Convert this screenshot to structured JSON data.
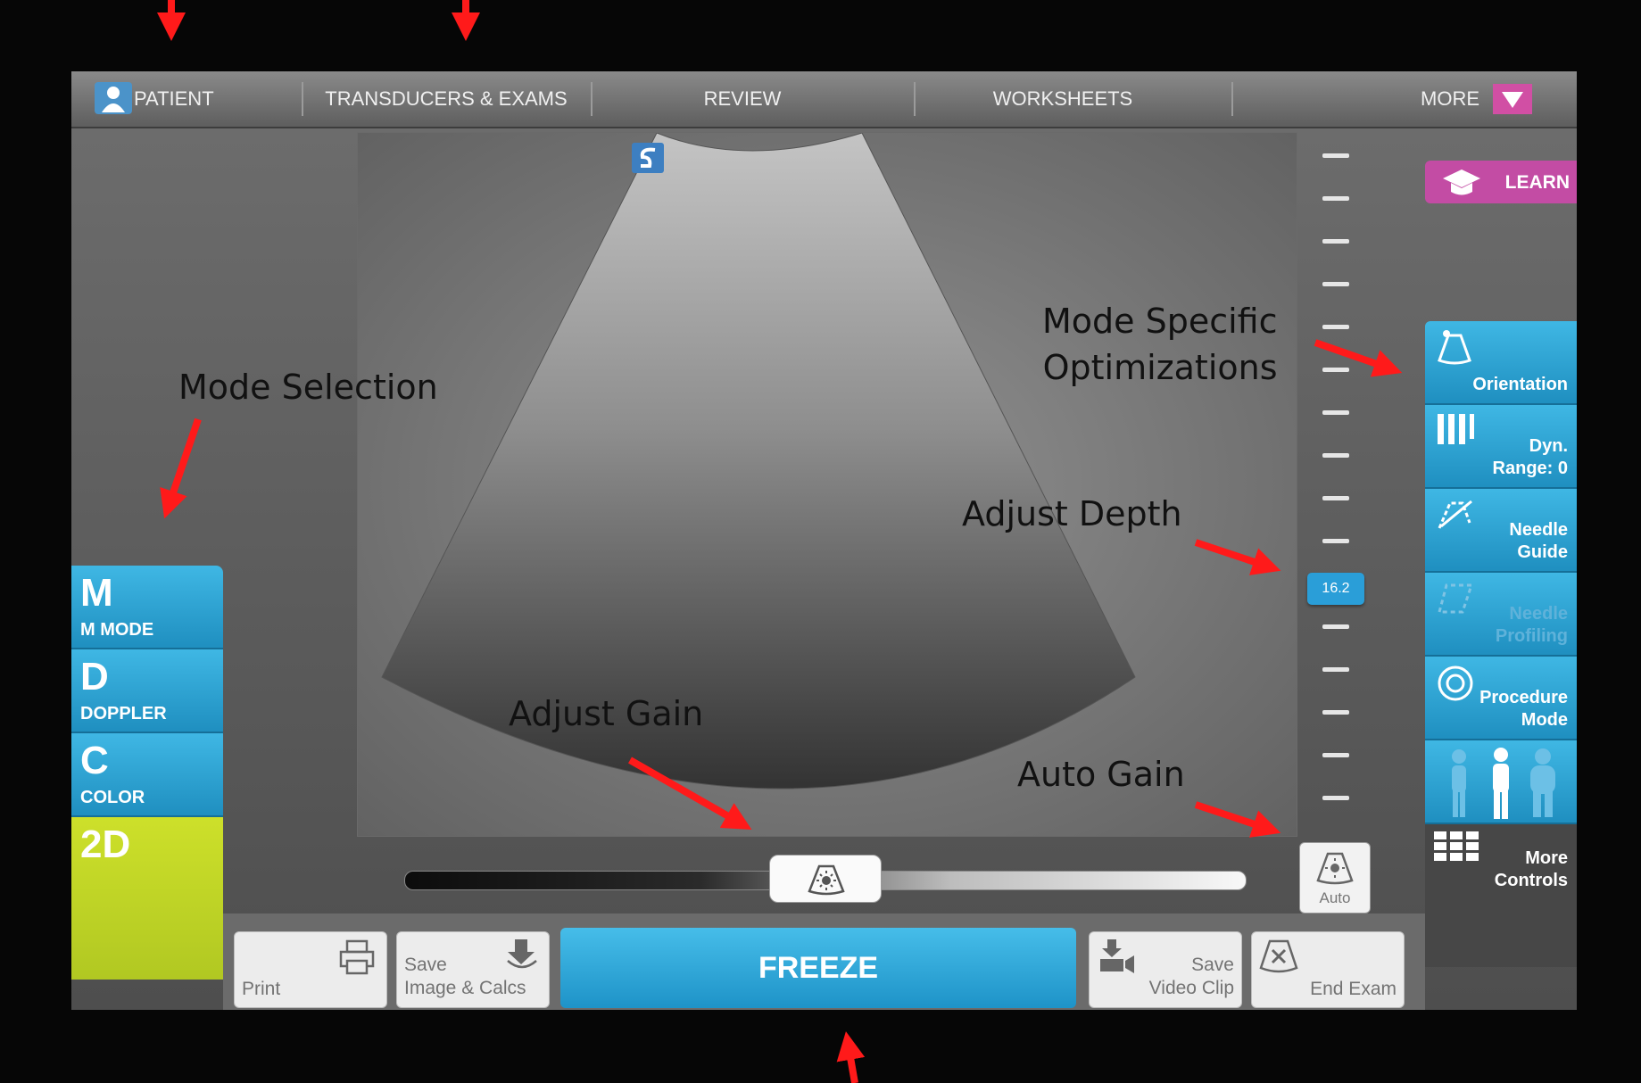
{
  "topnav": {
    "patient": "PATIENT",
    "transducers": "TRANSDUCERS & EXAMS",
    "review": "REVIEW",
    "worksheets": "WORKSHEETS",
    "more": "MORE"
  },
  "learn_label": "LEARN",
  "modes": [
    {
      "letter": "M",
      "label": "M MODE"
    },
    {
      "letter": "D",
      "label": "DOPPLER"
    },
    {
      "letter": "C",
      "label": "COLOR"
    },
    {
      "letter": "2D",
      "label": ""
    }
  ],
  "right_controls": {
    "orientation": "Orientation",
    "dyn_range": "Dyn.\nRange: 0",
    "needle_guide": "Needle\nGuide",
    "needle_profiling": "Needle\nProfiling",
    "procedure_mode": "Procedure\nMode",
    "more_controls": "More\nControls"
  },
  "depth_value": "16.2",
  "auto_label": "Auto",
  "bottom": {
    "print": "Print",
    "save_image": "Save\nImage & Calcs",
    "freeze": "FREEZE",
    "save_video": "Save\nVideo Clip",
    "end_exam": "End Exam"
  },
  "annotations": {
    "mode_selection": "Mode Selection",
    "mode_specific": "Mode Specific\nOptimizations",
    "adjust_depth": "Adjust Depth",
    "adjust_gain": "Adjust Gain",
    "auto_gain": "Auto Gain"
  },
  "colors": {
    "accent_blue": "#2a9ed8",
    "mode_2d": "#c3d626",
    "learn": "#c34ca4",
    "arrow_red": "#ff1a1a"
  },
  "gain_level": 0.43
}
